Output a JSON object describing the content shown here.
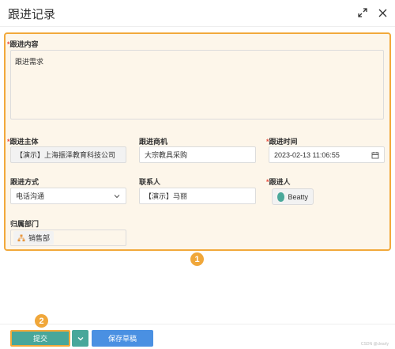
{
  "dialog": {
    "title": "跟进记录",
    "expand_icon": "expand-icon",
    "close_icon": "close-icon"
  },
  "form": {
    "content": {
      "required": "*",
      "label": "跟进内容",
      "value": "跟进需求"
    },
    "subject": {
      "required": "*",
      "label": "跟进主体",
      "value": "【演示】上海振泽教育科技公司"
    },
    "opportunity": {
      "label": "跟进商机",
      "value": "大宗教具采购"
    },
    "time": {
      "required": "*",
      "label": "跟进时间",
      "value": "2023-02-13 11:06:55",
      "icon": "calendar-icon"
    },
    "method": {
      "label": "跟进方式",
      "value": "电话沟通",
      "icon": "chevron-down-icon"
    },
    "contact": {
      "label": "联系人",
      "value": "【演示】马丽"
    },
    "follower": {
      "required": "*",
      "label": "跟进人",
      "value": "Beatty",
      "icon": "avatar-icon"
    },
    "department": {
      "label": "归属部门",
      "value": "销售部",
      "icon": "org-tree-icon"
    }
  },
  "annotations": {
    "badge1": "1",
    "badge2": "2"
  },
  "footer": {
    "submit_label": "提交",
    "dropdown_icon": "chevron-down-icon",
    "draft_label": "保存草稿",
    "watermark": "CSDN @clearly"
  },
  "colors": {
    "highlight": "#f2a93b",
    "form_bg": "#fdf6ea",
    "submit": "#48a79a",
    "draft": "#4a90e2",
    "required": "#e74c3c"
  }
}
